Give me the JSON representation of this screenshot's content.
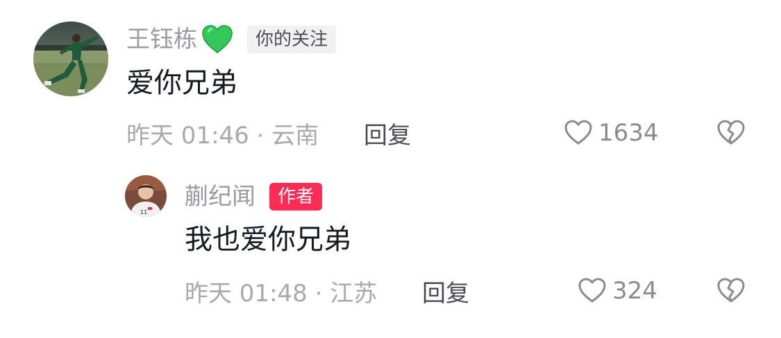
{
  "comments": [
    {
      "username": "王钰栋",
      "emoji": "green-heart-emoji",
      "tag": "你的关注",
      "text": "爱你兄弟",
      "time": "昨天 01:46 · 云南",
      "reply_label": "回复",
      "likes": "1634",
      "avatar": "soccer-player-celebrating-on-field"
    },
    {
      "username": "蒯纪闻",
      "tag": "作者",
      "text": "我也爱你兄弟",
      "time": "昨天 01:48 · 江苏",
      "reply_label": "回复",
      "likes": "324",
      "avatar": "player-portrait-white-jersey"
    }
  ],
  "colors": {
    "author_tag": "#fe2c55",
    "follow_tag_bg": "#f1f1f2",
    "username": "#9b9ba0",
    "text": "#161823",
    "meta": "#a8a8ad",
    "emoji_heart": "#34c759"
  }
}
